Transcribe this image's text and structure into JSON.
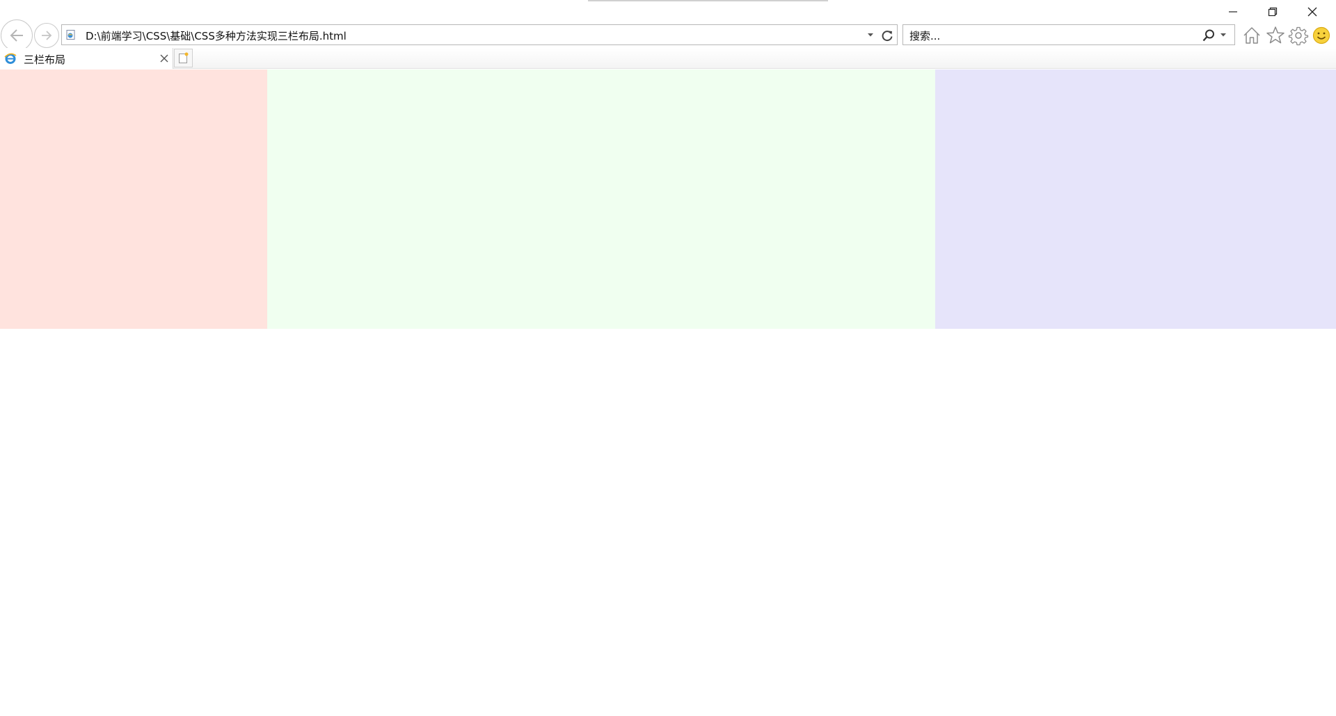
{
  "window": {
    "minimize_label": "Minimize",
    "restore_label": "Restore",
    "close_label": "Close"
  },
  "address_bar": {
    "url": "D:\\前端学习\\CSS\\基础\\CSS多种方法实现三栏布局.html"
  },
  "search": {
    "placeholder": "搜索..."
  },
  "toolbar": {
    "icons": [
      "home-icon",
      "star-icon",
      "gear-icon",
      "smiley-icon"
    ]
  },
  "tabs": [
    {
      "title": "三栏布局",
      "active": true
    }
  ],
  "page": {
    "columns": [
      {
        "name": "left",
        "color": "#ffe3de"
      },
      {
        "name": "center",
        "color": "#f0fff0"
      },
      {
        "name": "right",
        "color": "#e6e4fa"
      }
    ]
  }
}
